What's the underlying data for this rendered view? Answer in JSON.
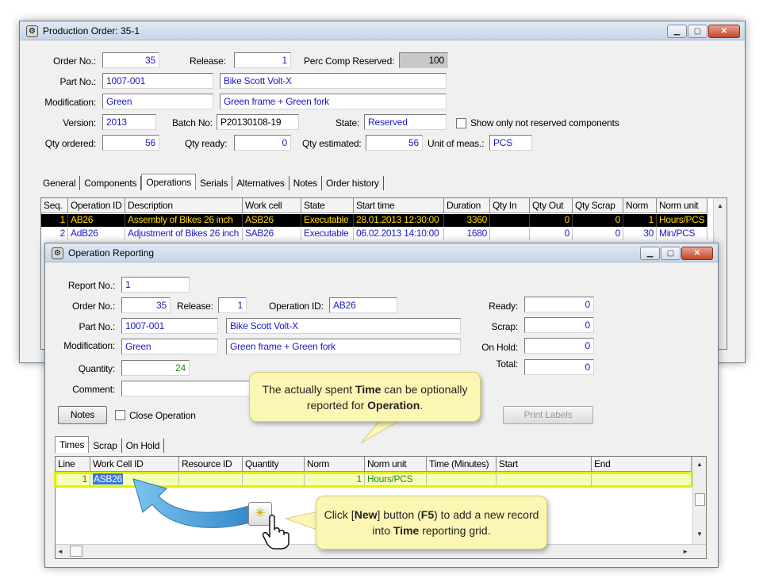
{
  "prod": {
    "title": "Production Order: 35-1",
    "order_no_label": "Order No.:",
    "order_no": "35",
    "release_label": "Release:",
    "release": "1",
    "perc_label": "Perc Comp Reserved:",
    "perc": "100",
    "part_no_label": "Part No.:",
    "part_no": "1007-001",
    "part_desc": "Bike Scott Volt-X",
    "mod_label": "Modification:",
    "mod": "Green",
    "mod_desc": "Green frame + Green fork",
    "version_label": "Version:",
    "version": "2013",
    "batch_label": "Batch No:",
    "batch": "P20130108-19",
    "state_label": "State:",
    "state": "Reserved",
    "show_label": "Show only not reserved components",
    "qty_ordered_label": "Qty ordered:",
    "qty_ordered": "56",
    "qty_ready_label": "Qty ready:",
    "qty_ready": "0",
    "qty_est_label": "Qty estimated:",
    "qty_est": "56",
    "uom_label": "Unit of meas.:",
    "uom": "PCS",
    "tabs": [
      "General",
      "Components",
      "Operations",
      "Serials",
      "Alternatives",
      "Notes",
      "Order history"
    ],
    "grid_headers": [
      "Seq.",
      "Operation ID",
      "Description",
      "Work cell",
      "State",
      "Start time",
      "Duration",
      "Qty In",
      "Qty Out",
      "Qty Scrap",
      "Norm",
      "Norm unit"
    ],
    "rows": [
      [
        "1",
        "AB26",
        "Assembly of Bikes 26 inch",
        "ASB26",
        "Executable",
        "28.01.2013 12:30:00",
        "3360",
        "",
        "0",
        "0",
        "1",
        "Hours/PCS"
      ],
      [
        "2",
        "AdB26",
        "Adjustment of Bikes 26 inch",
        "SAB26",
        "Executable",
        "06.02.2013 14:10:00",
        "1680",
        "",
        "0",
        "0",
        "30",
        "Min/PCS"
      ]
    ]
  },
  "oprep": {
    "title": "Operation Reporting",
    "report_no_label": "Report No.:",
    "report_no": "1",
    "order_no_label": "Order No.:",
    "order_no": "35",
    "release_label": "Release:",
    "release": "1",
    "opid_label": "Operation ID:",
    "opid": "AB26",
    "part_no_label": "Part No.:",
    "part_no": "1007-001",
    "part_desc": "Bike Scott Volt-X",
    "mod_label": "Modification:",
    "mod": "Green",
    "mod_desc": "Green frame + Green fork",
    "qty_label": "Quantity:",
    "qty": "24",
    "comment_label": "Comment:",
    "ready_label": "Ready:",
    "ready": "0",
    "scrap_label": "Scrap:",
    "scrap": "0",
    "onhold_label": "On Hold:",
    "onhold": "0",
    "total_label": "Total:",
    "total": "0",
    "notes_btn": "Notes",
    "close_op_label": "Close Operation",
    "print_btn": "Print Labels",
    "tabs": [
      "Times",
      "Scrap",
      "On Hold"
    ],
    "grid_headers": [
      "Line",
      "Work Cell ID",
      "Resource ID",
      "Quantity",
      "Norm",
      "Norm unit",
      "Time (Minutes)",
      "Start",
      "End"
    ],
    "row": [
      "1",
      "ASB26",
      "",
      "",
      "1",
      "Hours/PCS",
      "",
      "",
      ""
    ]
  },
  "callout1": {
    "pre": "The actually spent ",
    "b1": "Time",
    "mid": " can be optionally reported for ",
    "b2": "Operation",
    "post": "."
  },
  "callout2": {
    "pre": "Click [",
    "b1": "New",
    "mid1": "] button (",
    "b2": "F5",
    "mid2": ") to add a new record into ",
    "b3": "Time",
    "post": " reporting grid."
  },
  "colors": {
    "highlight": "#e4f000",
    "callout": "#fcf6b5",
    "arrow": "#3b9bd6"
  }
}
